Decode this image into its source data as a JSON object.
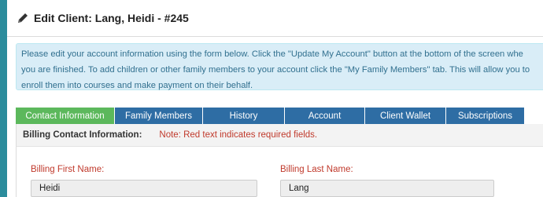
{
  "header": {
    "title": "Edit Client: Lang, Heidi - #245"
  },
  "info": {
    "lines": [
      "Please edit your account information using the form below. Click the \"Update My Account\" button at the bottom of the screen whe",
      "you are finished. To add children or other family members to your account click the \"My Family Members\" tab. This will allow you to",
      "enroll them into courses and make payment on their behalf."
    ]
  },
  "tabs": [
    {
      "label": "Contact Information",
      "active": true
    },
    {
      "label": "Family Members",
      "active": false
    },
    {
      "label": "History",
      "active": false
    },
    {
      "label": "Account",
      "active": false
    },
    {
      "label": "Client Wallet",
      "active": false
    },
    {
      "label": "Subscriptions",
      "active": false
    }
  ],
  "section": {
    "label": "Billing Contact Information:",
    "note": "Note: Red text indicates required fields."
  },
  "form": {
    "first_name_label": "Billing First Name:",
    "first_name_value": "Heidi",
    "last_name_label": "Billing Last Name:",
    "last_name_value": "Lang"
  },
  "colors": {
    "background": "#2b8c9c",
    "tab_active": "#5cb85c",
    "tab_inactive": "#2e6da4",
    "required_text": "#c0392b",
    "info_bg": "#d9edf7"
  }
}
